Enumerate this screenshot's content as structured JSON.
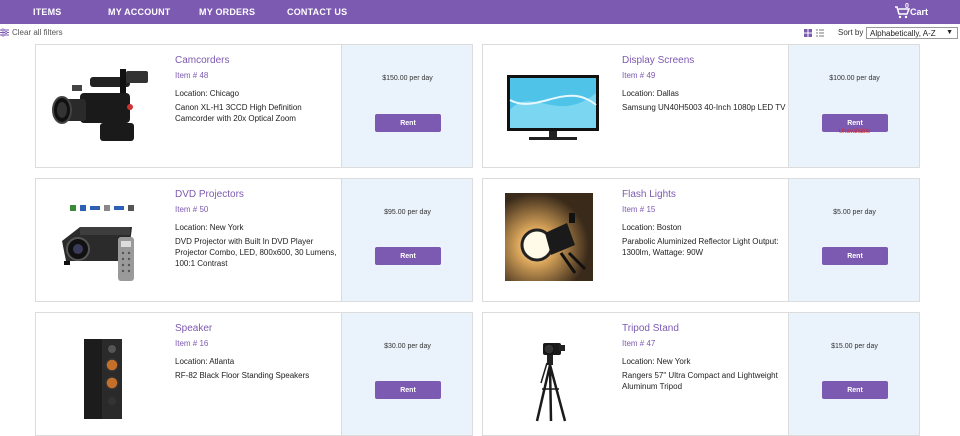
{
  "nav": {
    "items": [
      "ITEMS",
      "MY ACCOUNT",
      "MY ORDERS",
      "CONTACT US"
    ],
    "cart_label": "Cart",
    "cart_count": "0"
  },
  "filters": {
    "clear_label": "Clear all filters",
    "sort_label": "Sort by",
    "sort_value": "Alphabetically, A-Z"
  },
  "products": [
    {
      "title": "Camcorders",
      "item_no": "Item # 48",
      "location": "Location: Chicago",
      "description": "Canon XL-H1 3CCD High Definition Camcorder with 20x Optical Zoom",
      "price": "$150.00 per day",
      "rent_label": "Rent",
      "status": ""
    },
    {
      "title": "Display Screens",
      "item_no": "Item # 49",
      "location": "Location: Dallas",
      "description": "Samsung UN40H5003 40-Inch 1080p LED TV",
      "price": "$100.00 per day",
      "rent_label": "Rent",
      "status": "Unavailable"
    },
    {
      "title": "DVD Projectors",
      "item_no": "Item # 50",
      "location": "Location: New York",
      "description": "DVD Projector with Built In DVD Player Projector Combo, LED, 800x600, 30 Lumens, 100:1 Contrast",
      "price": "$95.00 per day",
      "rent_label": "Rent",
      "status": ""
    },
    {
      "title": "Flash Lights",
      "item_no": "Item # 15",
      "location": "Location: Boston",
      "description": "Parabolic Aluminized Reflector Light Output: 1300lm, Wattage: 90W",
      "price": "$5.00 per day",
      "rent_label": "Rent",
      "status": ""
    },
    {
      "title": "Speaker",
      "item_no": "Item # 16",
      "location": "Location: Atlanta",
      "description": "RF-82 Black Floor Standing Speakers",
      "price": "$30.00 per day",
      "rent_label": "Rent",
      "status": ""
    },
    {
      "title": "Tripod Stand",
      "item_no": "Item # 47",
      "location": "Location: New York",
      "description": "Rangers 57\" Ultra Compact and Lightweight Aluminum Tripod",
      "price": "$15.00 per day",
      "rent_label": "Rent",
      "status": ""
    }
  ]
}
